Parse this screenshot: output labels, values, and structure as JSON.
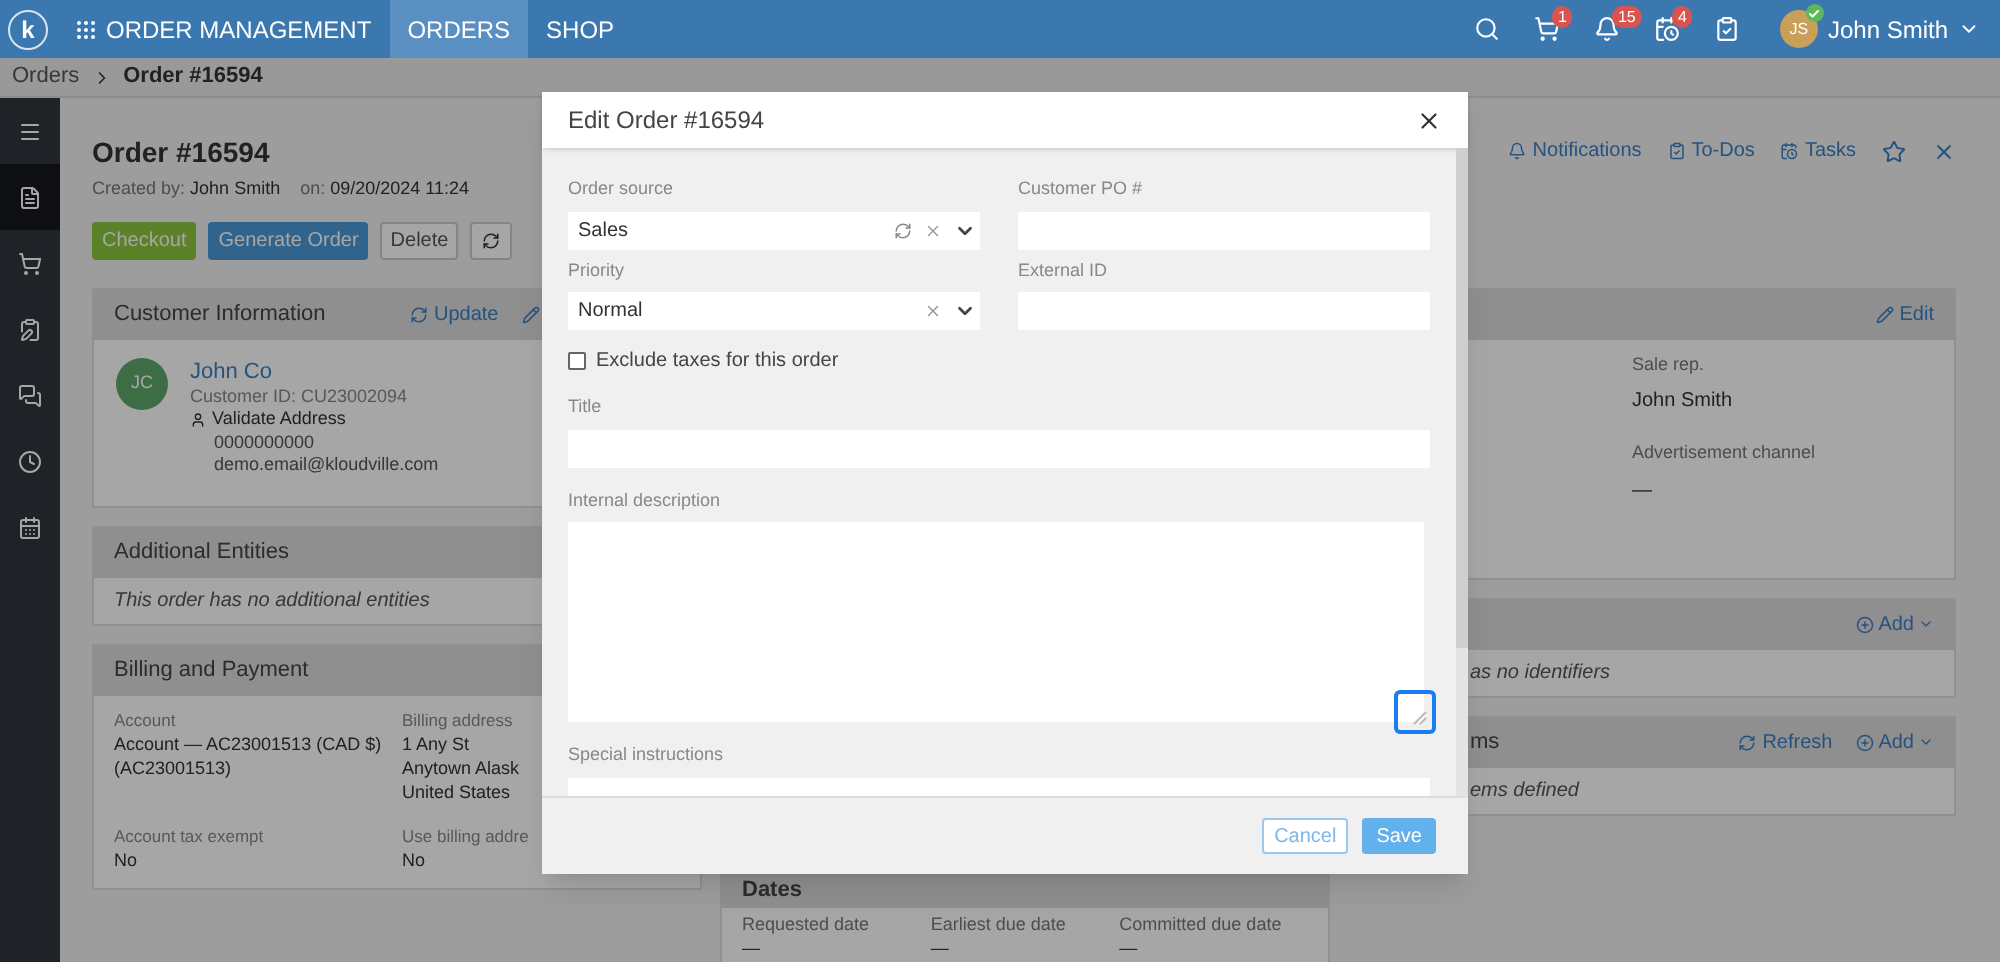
{
  "nav": {
    "logo": "k",
    "title": "ORDER MANAGEMENT",
    "tabs": [
      {
        "label": "ORDERS",
        "selected": true
      },
      {
        "label": "SHOP",
        "selected": false
      }
    ],
    "cart_count": "1",
    "notification_count": "15",
    "task_count": "4",
    "user": {
      "initials": "JS",
      "name": "John Smith",
      "online": true
    }
  },
  "breadcrumb": [
    "Orders",
    "Order #16594"
  ],
  "sidebar": [
    {
      "selected": false
    },
    {
      "selected": true
    },
    {
      "selected": false
    },
    {
      "selected": false
    },
    {
      "selected": false
    },
    {
      "selected": false
    },
    {
      "selected": false
    }
  ],
  "order": {
    "title": "Order #16594",
    "created_by_label": "Created by:",
    "created_by": "John Smith",
    "on_label": "on:",
    "date": "09/20/2024 11:24",
    "actions": [
      {
        "label": "Checkout",
        "kind": "success"
      },
      {
        "label": "Generate Order",
        "kind": "primary"
      },
      {
        "label": "Delete",
        "kind": "default"
      }
    ]
  },
  "header_links": [
    "Notifications",
    "To-Dos",
    "Tasks"
  ],
  "customer": {
    "title": "Customer Information",
    "update": "Update",
    "initials": "JC",
    "name": "John Co",
    "customer_id": "Customer ID: CU23002094",
    "validate": "Validate Address",
    "phone": "0000000000",
    "email": "demo.email@kloudville.com"
  },
  "entities": {
    "title": "Additional Entities",
    "empty": "This order has no additional entities"
  },
  "billing": {
    "title": "Billing and Payment",
    "fields": [
      {
        "label": "Account",
        "lines": [
          "Account — AC23001513 (CAD $)",
          "(AC23001513)"
        ]
      },
      {
        "label": "Billing address",
        "lines": [
          "1 Any St",
          "Anytown Alask",
          "United States"
        ]
      },
      {
        "label": "Account tax exempt",
        "lines": [
          "No"
        ]
      },
      {
        "label": "Use billing addre",
        "lines": [
          "No"
        ]
      }
    ]
  },
  "details": {
    "edit": "Edit",
    "fields": [
      {
        "label": "Sale rep.",
        "value": "John Smith"
      },
      {
        "label": "Advertisement channel",
        "value": "—"
      }
    ]
  },
  "identifiers": {
    "add": "Add",
    "empty": "as no identifiers"
  },
  "items": {
    "title": "ms",
    "refresh": "Refresh",
    "add": "Add",
    "empty": "ems defined"
  },
  "dates": {
    "title": "Dates",
    "fields": [
      {
        "label": "Requested date",
        "value": "—"
      },
      {
        "label": "Earliest due date",
        "value": "—"
      },
      {
        "label": "Committed due date",
        "value": "—"
      }
    ]
  },
  "modal": {
    "title": "Edit Order #16594",
    "order_source": {
      "label": "Order source",
      "value": "Sales"
    },
    "customer_po": {
      "label": "Customer PO #"
    },
    "priority": {
      "label": "Priority",
      "value": "Normal"
    },
    "external_id": {
      "label": "External ID"
    },
    "exclude_taxes": {
      "label": "Exclude taxes for this order",
      "checked": false
    },
    "title_field": {
      "label": "Title"
    },
    "internal_description": {
      "label": "Internal description"
    },
    "special_instructions": {
      "label": "Special instructions"
    },
    "cancel": "Cancel",
    "save": "Save"
  }
}
